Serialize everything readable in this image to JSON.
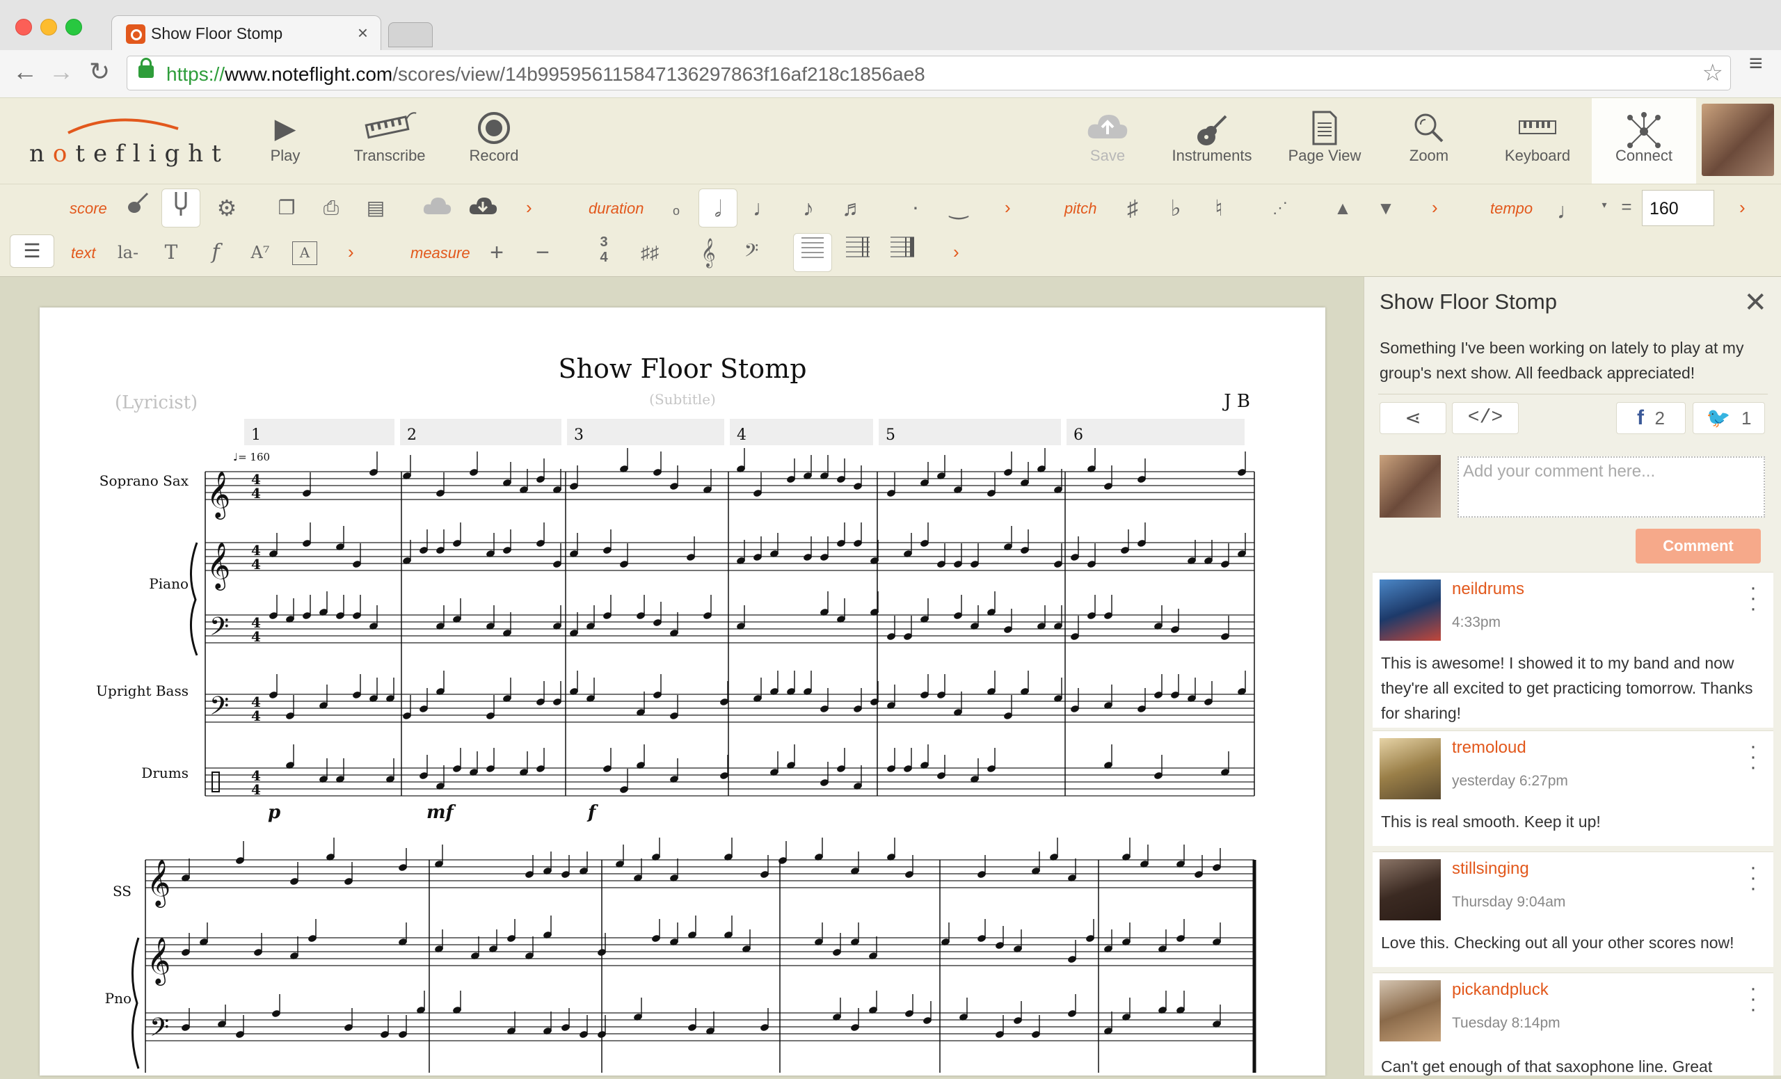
{
  "browser": {
    "tab_title": "Show Floor Stomp",
    "tab_close": "×",
    "url_scheme": "https://",
    "url_domain": "www.noteflight.com",
    "url_path": "/scores/view/14b995956115847136297863f16af218c1856ae8"
  },
  "app": {
    "logo_text": "noteflight",
    "toolbar": [
      {
        "icon": "play-icon",
        "label": "Play"
      },
      {
        "icon": "keyboard-transcribe-icon",
        "label": "Transcribe"
      },
      {
        "icon": "record-icon",
        "label": "Record"
      },
      {
        "icon": "cloud-save-icon",
        "label": "Save",
        "disabled": true
      },
      {
        "icon": "guitar-icon",
        "label": "Instruments"
      },
      {
        "icon": "page-icon",
        "label": "Page View"
      },
      {
        "icon": "zoom-icon",
        "label": "Zoom"
      },
      {
        "icon": "keyboard-icon",
        "label": "Keyboard"
      },
      {
        "icon": "connect-icon",
        "label": "Connect",
        "active": true
      }
    ]
  },
  "palette": {
    "groups": {
      "score": "score",
      "duration": "duration",
      "pitch": "pitch",
      "tempo": "tempo",
      "text": "text",
      "measure": "measure"
    },
    "tempo_value": "160",
    "tempo_equals": "=",
    "text_lyric": "la-",
    "text_bold": "T",
    "text_dynamic": "f",
    "text_superscript": "A⁷",
    "text_box": "A"
  },
  "score": {
    "title": "Show Floor Stomp",
    "subtitle_placeholder": "(Subtitle)",
    "lyricist_placeholder": "(Lyricist)",
    "composer": "J B",
    "tempo_marking": "♩= 160",
    "measure_numbers": [
      "1",
      "2",
      "3",
      "4",
      "5",
      "6"
    ],
    "parts": [
      "Soprano Sax",
      "Piano",
      "Upright Bass",
      "Drums"
    ],
    "parts_short": [
      "SS",
      "Pno"
    ],
    "dynamics": [
      "p",
      "mf",
      "f"
    ]
  },
  "panel": {
    "title": "Show Floor Stomp",
    "close": "✕",
    "description": "Something I've been working on lately to play at my group's next show. All feedback appreciated!",
    "embed_label": "</>",
    "facebook_count": "2",
    "twitter_count": "1",
    "comment_placeholder": "Add your comment here...",
    "comment_button": "Comment",
    "comments": [
      {
        "user": "neildrums",
        "time": "4:33pm",
        "text": "This is awesome! I showed it to my band and now they're all excited to get practicing tomorrow. Thanks for sharing!",
        "color": "#3a6fb0"
      },
      {
        "user": "tremoloud",
        "time": "yesterday 6:27pm",
        "text": "This is real smooth. Keep it up!",
        "color": "#b59a5e"
      },
      {
        "user": "stillsinging",
        "time": "Thursday 9:04am",
        "text": "Love this. Checking out all your other scores now!",
        "color": "#5a4234"
      },
      {
        "user": "pickandpluck",
        "time": "Tuesday 8:14pm",
        "text": "Can't get enough of that saxophone line. Great",
        "color": "#a08466"
      }
    ]
  },
  "colors": {
    "accent": "#e2581c",
    "toolbar_bg": "#efeddc",
    "workspace_bg": "#d9d9c4"
  }
}
